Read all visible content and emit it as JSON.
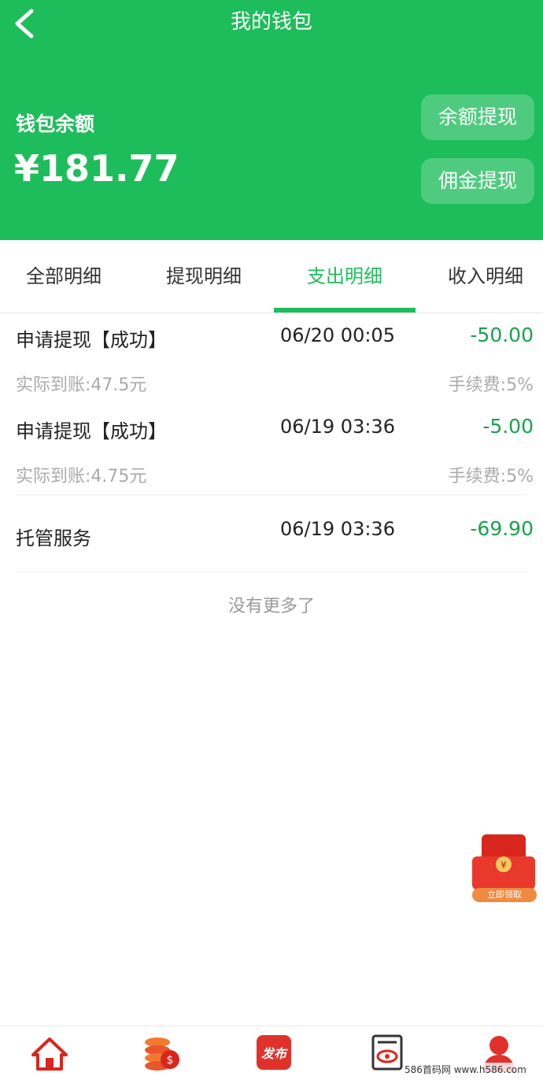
{
  "header": {
    "title": "我的钱包",
    "balance_label": "钱包余额",
    "balance_amount": "¥181.77",
    "buttons": {
      "withdraw_balance": "余额提现",
      "withdraw_commission": "佣金提现"
    }
  },
  "tabs": [
    {
      "label": "全部明细"
    },
    {
      "label": "提现明细"
    },
    {
      "label": "支出明细",
      "active": true
    },
    {
      "label": "收入明细"
    }
  ],
  "records": [
    {
      "title": "申请提现【成功】",
      "time": "06/20 00:05",
      "amount": "-50.00",
      "received": "实际到账:47.5元",
      "fee": "手续费:5%"
    },
    {
      "title": "申请提现【成功】",
      "time": "06/19 03:36",
      "amount": "-5.00",
      "received": "实际到账:4.75元",
      "fee": "手续费:5%"
    },
    {
      "title": "托管服务",
      "time": "06/19 03:36",
      "amount": "-69.90"
    }
  ],
  "no_more": "没有更多了",
  "red_packet": {
    "label": "立即领取"
  },
  "bottom_nav": [
    {
      "icon": "home-icon"
    },
    {
      "icon": "coins-icon"
    },
    {
      "icon": "publish-icon",
      "label": "发布"
    },
    {
      "icon": "eye-document-icon"
    },
    {
      "icon": "user-icon"
    }
  ],
  "watermark": "586首码网 www.h586.com",
  "colors": {
    "brand_green": "#1ebd5b",
    "amount_green": "#17a34a",
    "nav_red": "#e0322b"
  }
}
